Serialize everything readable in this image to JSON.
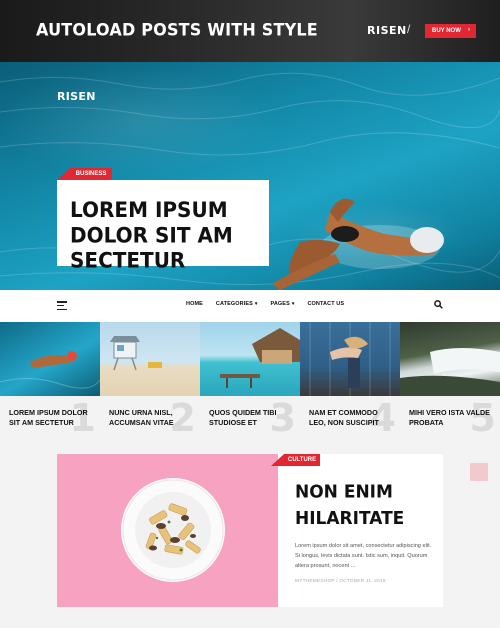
{
  "header": {
    "title": "AUTOLOAD POSTS WITH STYLE",
    "brand": "RISEN",
    "separator": "/",
    "buy_label": "BUY NOW",
    "buy_chevron": "›"
  },
  "hero": {
    "logo": "RISEN",
    "tag": "BUSINESS",
    "headline": "LOREM IPSUM DOLOR SIT AM SECTETUR"
  },
  "nav": {
    "items": [
      {
        "label": "HOME",
        "caret": ""
      },
      {
        "label": "CATEGORIES",
        "caret": "▾"
      },
      {
        "label": "PAGES",
        "caret": "▾"
      },
      {
        "label": "CONTACT US",
        "caret": ""
      }
    ],
    "icons": [
      "menu-icon",
      "search-icon"
    ]
  },
  "posts": [
    {
      "title": "LOREM IPSUM DOLOR SIT AM SECTETUR",
      "num": "1"
    },
    {
      "title": "NUNC URNA NISL, ACCUMSAN VITAE",
      "num": "2"
    },
    {
      "title": "QUOS QUIDEM TIBI STUDIOSE ET",
      "num": "3"
    },
    {
      "title": "NAM ET COMMODO LEO, NON SUSCIPIT",
      "num": "4"
    },
    {
      "title": "MIHI VERO ISTA VALDE PROBATA",
      "num": "5"
    }
  ],
  "featured": {
    "tag": "CULTURE",
    "title": "NON ENIM HILARITATE",
    "excerpt": "Lorem ipsum dolor sit amet, consectetur adipiscing elit. Si longus, levis dictata sunt. Istic sum, inquit. Quorum altera prosunt, nocent ...",
    "meta": "MYTHEMESHOP / OCTOBER 11, 2018"
  },
  "colors": {
    "accent": "#e12732",
    "featured_bg": "#f7a2c0"
  }
}
